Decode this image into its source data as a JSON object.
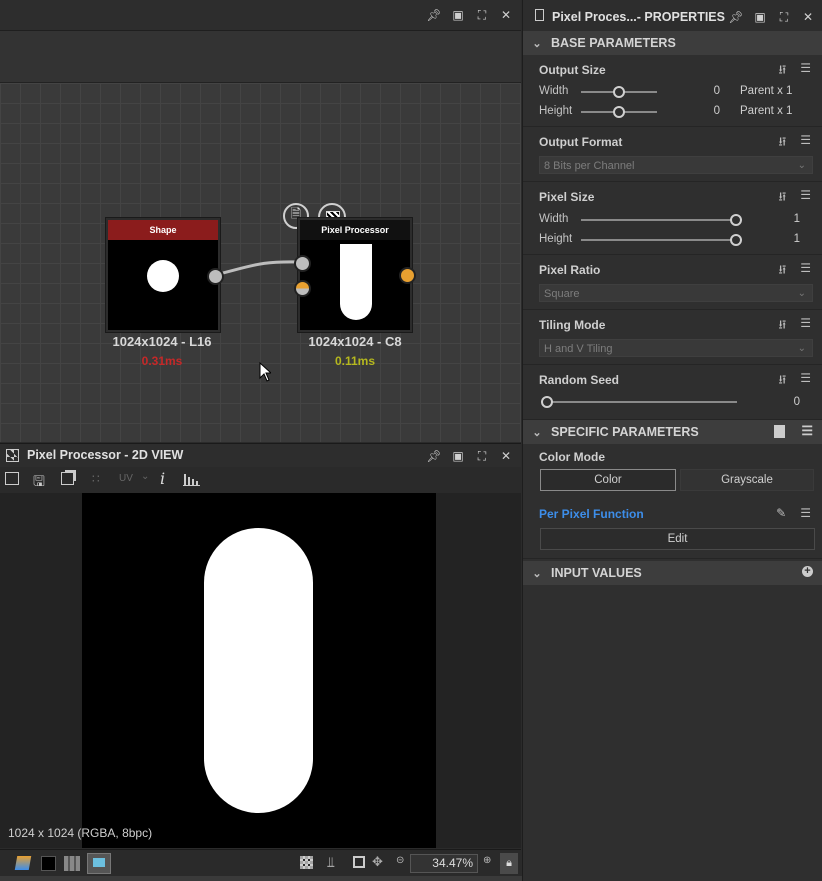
{
  "graph": {
    "nodes": [
      {
        "title": "Shape",
        "resolution": "1024x1024 - L16",
        "time": "0.31ms",
        "title_color": "#8b1c1c",
        "time_color": "#c62828"
      },
      {
        "title": "Pixel Processor",
        "resolution": "1024x1024 - C8",
        "time": "0.11ms",
        "title_color": "#111111",
        "time_color": "#b5b81e"
      }
    ]
  },
  "view": {
    "title": "Pixel Processor - 2D VIEW",
    "uv_label": "UV",
    "image_info": "1024 x 1024 (RGBA, 8bpc)",
    "zoom": "34.47%"
  },
  "props": {
    "title": "Pixel Proces...- PROPERTIES",
    "base_section": "BASE PARAMETERS",
    "output_size": {
      "label": "Output Size",
      "width_label": "Width",
      "height_label": "Height",
      "width_value": "0",
      "height_value": "0",
      "width_suffix": "Parent x 1",
      "height_suffix": "Parent x 1"
    },
    "output_format": {
      "label": "Output Format",
      "value": "8 Bits per Channel"
    },
    "pixel_size": {
      "label": "Pixel Size",
      "width_label": "Width",
      "height_label": "Height",
      "width_value": "1",
      "height_value": "1"
    },
    "pixel_ratio": {
      "label": "Pixel Ratio",
      "value": "Square"
    },
    "tiling_mode": {
      "label": "Tiling Mode",
      "value": "H and V Tiling"
    },
    "random_seed": {
      "label": "Random Seed",
      "value": "0"
    },
    "specific_section": "SPECIFIC PARAMETERS",
    "color_mode": {
      "label": "Color Mode",
      "option_color": "Color",
      "option_grayscale": "Grayscale",
      "selected": "Color"
    },
    "per_pixel": {
      "label": "Per Pixel Function",
      "edit": "Edit"
    },
    "input_section": "INPUT VALUES"
  },
  "colors": {
    "accent_link": "#3d8eea",
    "port_orange": "#e8a030"
  }
}
